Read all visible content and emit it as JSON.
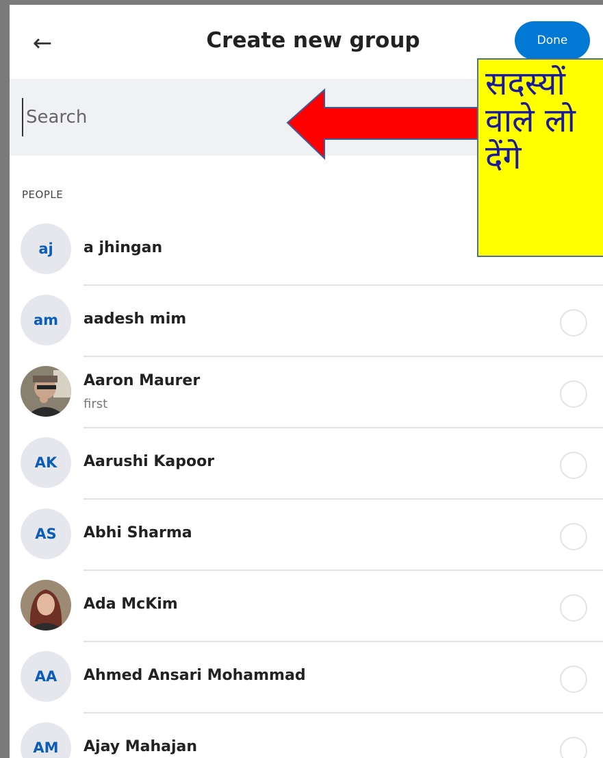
{
  "header": {
    "title": "Create new group",
    "done_label": "Done"
  },
  "search": {
    "placeholder": "Search"
  },
  "annotation": {
    "text": "सदस्यों\nवाले लो\nदेंगे"
  },
  "section": {
    "label": "PEOPLE"
  },
  "contacts": [
    {
      "initials": "aj",
      "name": "a jhingan",
      "sub": "",
      "photo": false
    },
    {
      "initials": "am",
      "name": "aadesh mim",
      "sub": "",
      "photo": false
    },
    {
      "initials": "",
      "name": "Aaron Maurer",
      "sub": "first",
      "photo": true
    },
    {
      "initials": "AK",
      "name": "Aarushi Kapoor",
      "sub": "",
      "photo": false
    },
    {
      "initials": "AS",
      "name": "Abhi Sharma",
      "sub": "",
      "photo": false
    },
    {
      "initials": "",
      "name": "Ada McKim",
      "sub": "",
      "photo": true
    },
    {
      "initials": "AA",
      "name": "Ahmed Ansari Mohammad",
      "sub": "",
      "photo": false
    },
    {
      "initials": "AM",
      "name": "Ajay Mahajan",
      "sub": "",
      "photo": false
    }
  ],
  "colors": {
    "accent": "#0078d4",
    "annotation_bg": "#ffff00",
    "annotation_text": "#1a1a9c",
    "arrow": "#ff0000"
  },
  "icons": {
    "back": "back-arrow-icon"
  }
}
